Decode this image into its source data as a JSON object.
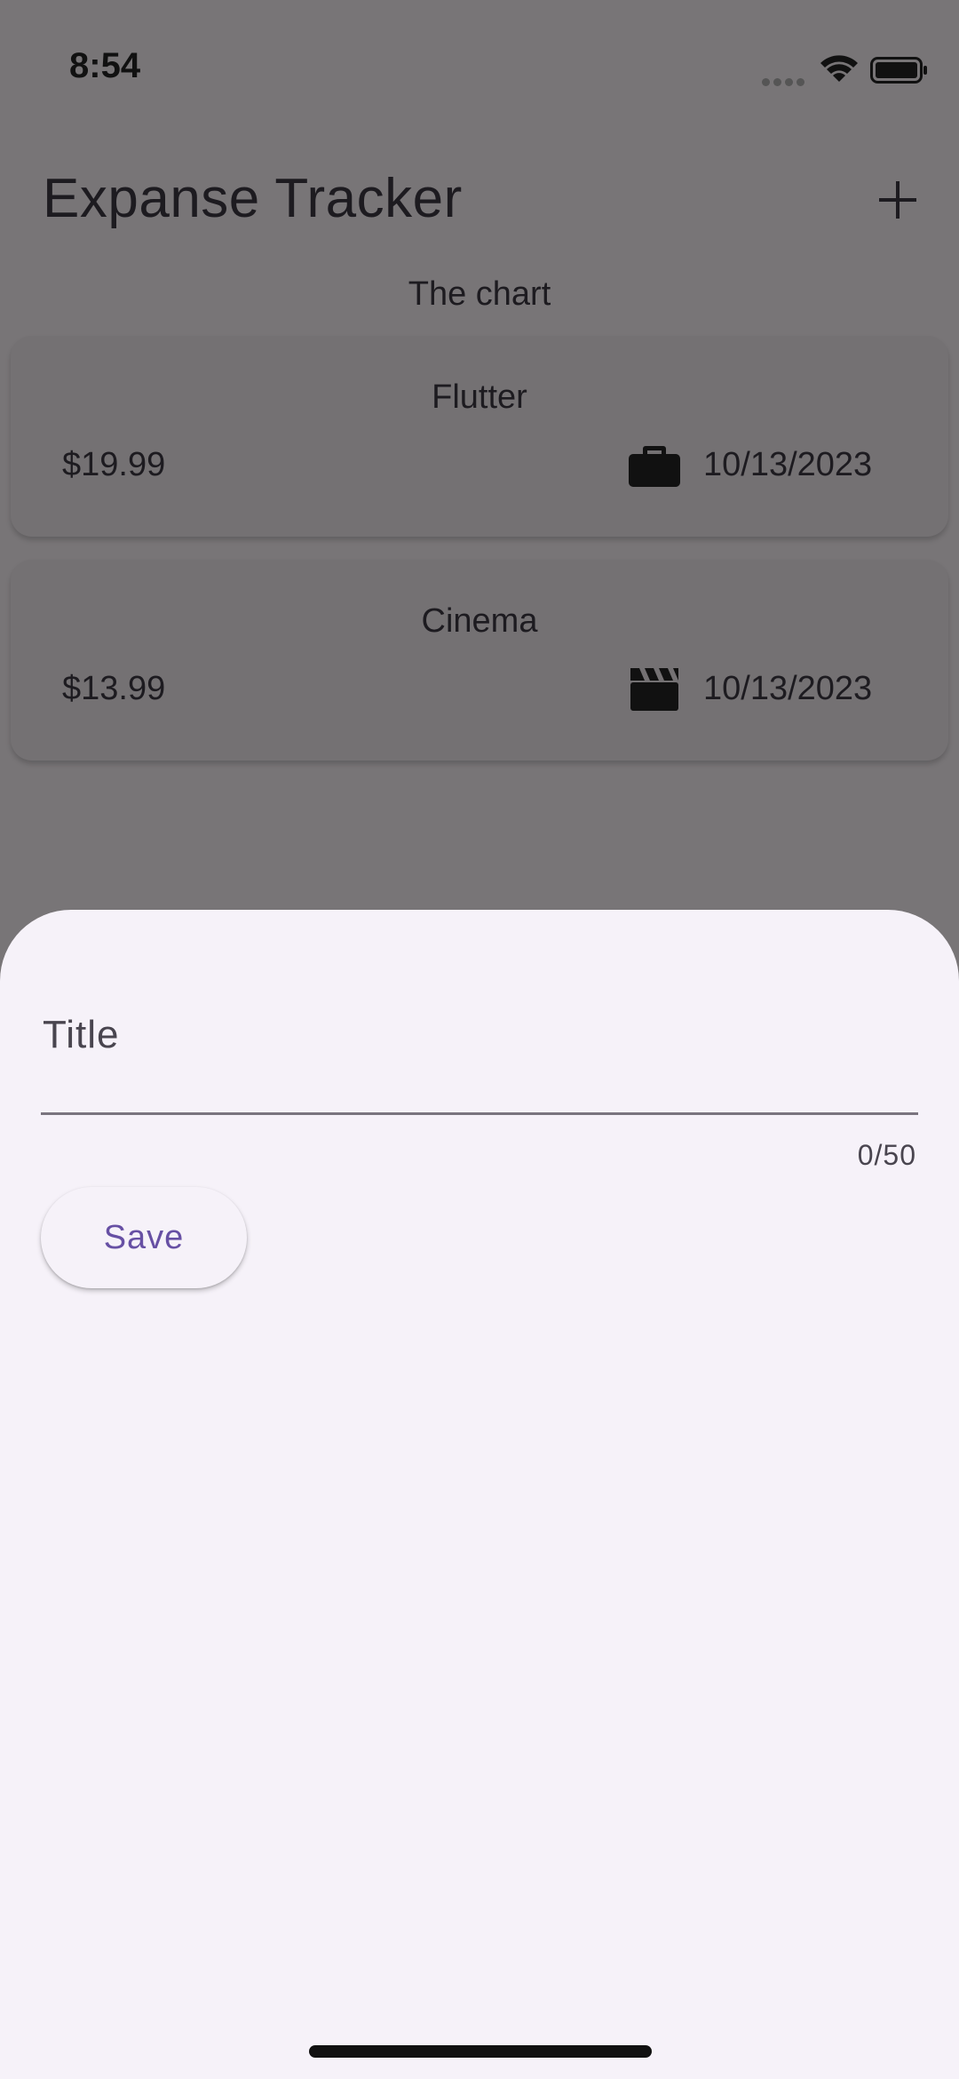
{
  "status_bar": {
    "time": "8:54"
  },
  "app_bar": {
    "title": "Expanse Tracker",
    "add_icon": "plus-icon"
  },
  "chart": {
    "label": "The chart"
  },
  "expenses": [
    {
      "title": "Flutter",
      "amount": "$19.99",
      "date": "10/13/2023",
      "icon": "briefcase-icon"
    },
    {
      "title": "Cinema",
      "amount": "$13.99",
      "date": "10/13/2023",
      "icon": "movie-clapper-icon"
    }
  ],
  "sheet": {
    "title_label": "Title",
    "title_value": "",
    "counter": "0/50",
    "save_label": "Save"
  },
  "colors": {
    "scrim_background": "#787577",
    "sheet_background": "#f6f2f9",
    "accent": "#6750a4"
  }
}
